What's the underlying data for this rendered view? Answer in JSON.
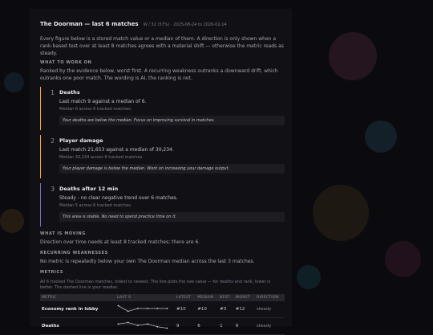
{
  "header": {
    "title": "The Doorman — last 6 matches",
    "subtitle": "W / 32 (57%) · 2025-08-24 to 2026-02-14"
  },
  "intro": "Every figure below is a stored match value or a median of them. A direction is only shown when a rank-based test over at least 8 matches agrees with a material shift — otherwise the metric reads as steady.",
  "work_on": {
    "heading": "WHAT TO WORK ON",
    "text": "Ranked by the evidence below, worst first. A recurring weakness outranks a downward drift, which outranks one poor match. The wording is AI, the ranking is not.",
    "items": [
      {
        "number": "1",
        "title": "Deaths",
        "line": "Last match 9 against a median of 6.",
        "sub": "Median 6 across 6 tracked matches.",
        "note": "Your deaths are below the median. Focus on improving survival in matches."
      },
      {
        "number": "2",
        "title": "Player damage",
        "line": "Last match 21,653 against a median of 30,234.",
        "sub": "Median 30,234 across 6 tracked matches.",
        "note": "Your player damage is below the median. Work on increasing your damage output."
      },
      {
        "number": "3",
        "title": "Deaths after 12 min",
        "line": "Steady - no clear negative trend over 6 matches.",
        "sub": "Median 5 across 6 tracked matches.",
        "note": "This area is stable. No need to spend practice time on it."
      }
    ]
  },
  "moving": {
    "heading": "WHAT IS MOVING",
    "text": "Direction over time needs at least 8 tracked matches; there are 6."
  },
  "recurring": {
    "heading": "RECURRING WEAKNESSES",
    "text": "No metric is repeatedly below your own The Doorman median across the last 3 matches."
  },
  "metrics": {
    "heading": "METRICS",
    "caption": "All 6 tracked The Doorman matches, oldest to newest. The line plots the raw value — for deaths and rank, lower is better. The dashed line is your median.",
    "columns": [
      "METRIC",
      "LAST 6",
      "LATEST",
      "MEDIAN",
      "BEST",
      "WORST",
      "DIRECTION"
    ],
    "rows": [
      {
        "metric": "Economy rank in lobby",
        "spark": [
          9,
          11,
          10,
          10,
          10,
          10
        ],
        "latest": "#10",
        "median": "#10",
        "best": "#3",
        "worst": "#12",
        "direction": "steady"
      },
      {
        "metric": "Deaths",
        "spark": [
          6,
          5,
          7,
          6,
          8,
          9
        ],
        "latest": "9",
        "median": "6",
        "best": "1",
        "worst": "9",
        "direction": "steady"
      }
    ]
  },
  "colors": {
    "accent_orange": "#f2a53a",
    "accent_muted": "#6e73b8"
  }
}
